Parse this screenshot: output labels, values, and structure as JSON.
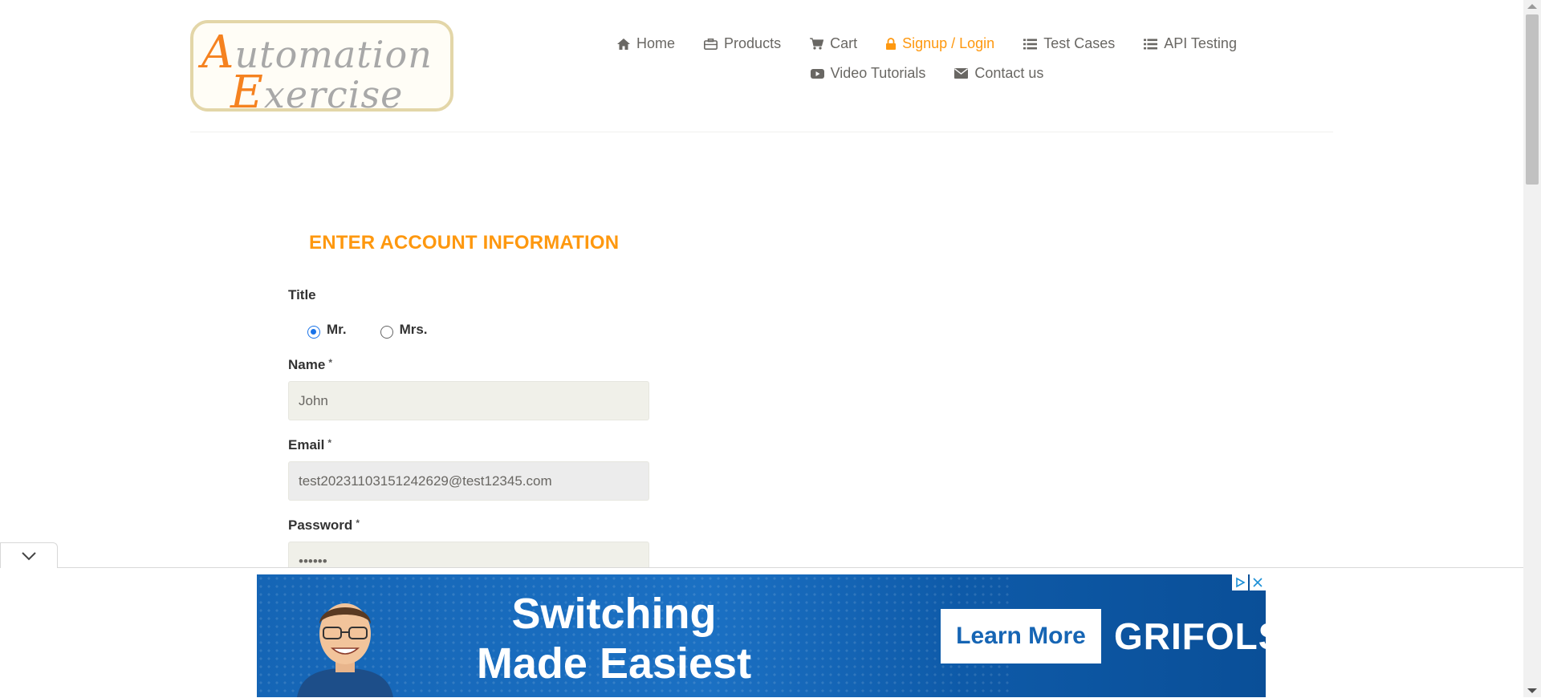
{
  "logo": {
    "line1_cap": "A",
    "line1_rest": "utomation",
    "line2_cap": "E",
    "line2_rest": "xercise"
  },
  "nav": {
    "row1": [
      {
        "label": "Home",
        "icon": "home-icon"
      },
      {
        "label": "Products",
        "icon": "briefcase-icon"
      },
      {
        "label": "Cart",
        "icon": "cart-icon"
      },
      {
        "label": "Signup / Login",
        "icon": "lock-icon",
        "active": true
      },
      {
        "label": "Test Cases",
        "icon": "list-icon"
      },
      {
        "label": "API Testing",
        "icon": "list-icon"
      }
    ],
    "row2": [
      {
        "label": "Video Tutorials",
        "icon": "youtube-play-icon"
      },
      {
        "label": "Contact us",
        "icon": "envelope-icon"
      }
    ]
  },
  "form": {
    "heading": "ENTER ACCOUNT INFORMATION",
    "title_label": "Title",
    "title_options": [
      {
        "label": "Mr.",
        "checked": true
      },
      {
        "label": "Mrs.",
        "checked": false
      }
    ],
    "name_label": "Name",
    "name_value": "John",
    "email_label": "Email",
    "email_value": "test20231103151242629@test12345.com",
    "password_label": "Password",
    "password_value": "••••••",
    "required_mark": "*"
  },
  "ad": {
    "headline": "Switching Made Easiest",
    "cta": "Learn More",
    "brand": "GRIFOLS",
    "bg_color": "#1565b5"
  },
  "colors": {
    "accent": "#fe980f",
    "nav_text": "#696763",
    "radio_checked": "#1a73e8"
  }
}
